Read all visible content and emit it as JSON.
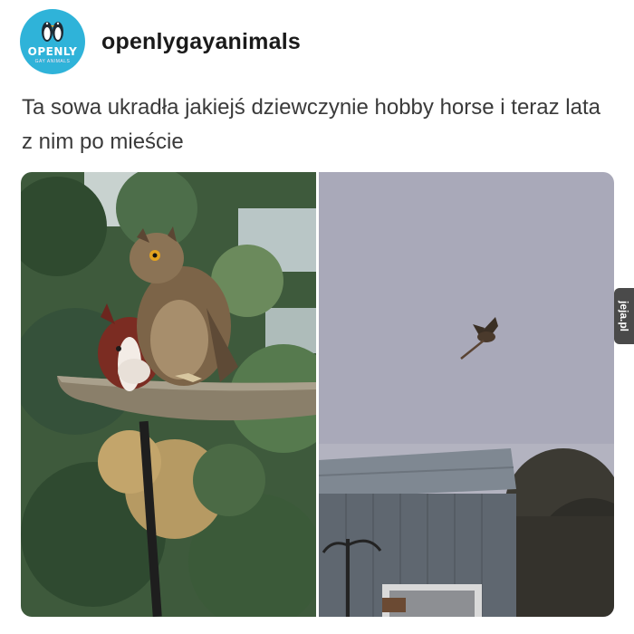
{
  "post": {
    "author": {
      "username": "openlygayanimals",
      "avatar_logo_text": "OPENLY",
      "avatar_logo_subtext": "GAY ANIMALS"
    },
    "caption": "Ta sowa ukradła jakiejś dziewczynie hobby horse i teraz lata z nim po mieście",
    "images": [
      {
        "icon": "owl-on-branch-with-hobby-horse-photo"
      },
      {
        "icon": "owl-flying-over-house-photo"
      }
    ]
  },
  "watermark": {
    "text": "jeja.pl"
  },
  "colors": {
    "avatar_bg": "#2fb3d9",
    "username": "#1a1a1a",
    "caption": "#3a3a3a",
    "watermark_bg": "#4a4a4a"
  }
}
